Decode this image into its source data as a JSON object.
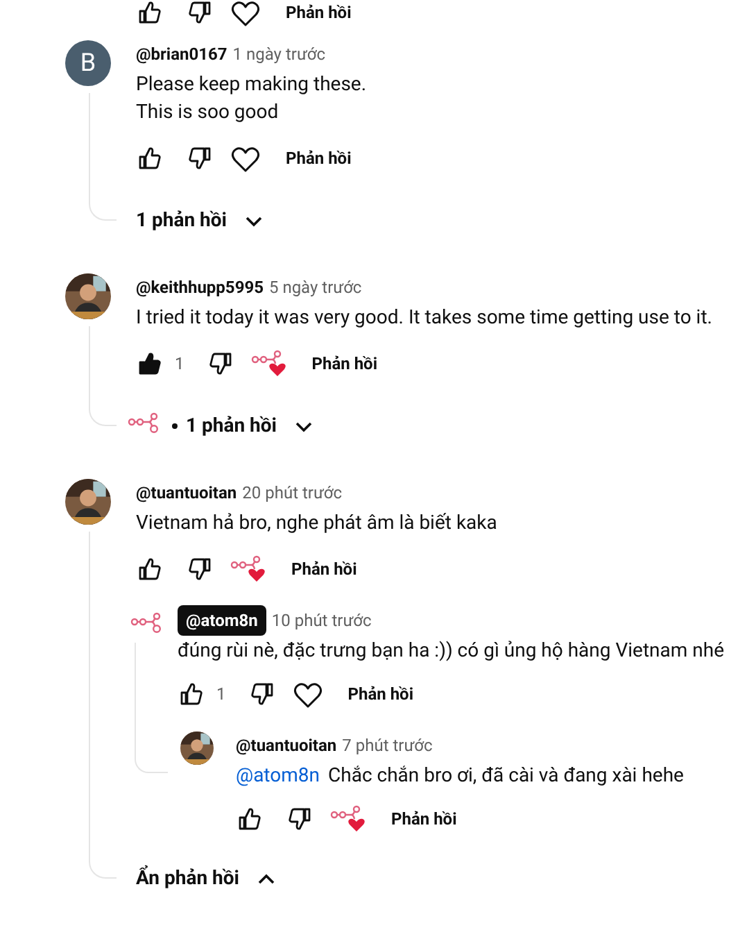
{
  "top_actions": {
    "liked": false,
    "creator_heart": false,
    "reply_label": "Phản hồi"
  },
  "comments": [
    {
      "author": "@brian0167",
      "owner": false,
      "time": "1 ngày trước",
      "avatar": {
        "kind": "letter",
        "letter": "B",
        "color": "#4a5e6e"
      },
      "text": "Please keep making these.\nThis is soo good",
      "actions": {
        "liked": false,
        "creator_heart": false,
        "reply_label": "Phản hồi"
      },
      "replies_toggle": {
        "label": "1 phản hồi",
        "expanded": false,
        "creator": false
      }
    },
    {
      "author": "@keithhupp5995",
      "owner": false,
      "time": "5 ngày trước",
      "avatar": {
        "kind": "picture"
      },
      "text": "I tried it today it was very good. It takes some time getting use to it.",
      "actions": {
        "liked": true,
        "like_count": "1",
        "creator_heart": true,
        "reply_label": "Phản hồi"
      },
      "replies_toggle": {
        "label": "1 phản hồi",
        "expanded": false,
        "creator": true
      }
    },
    {
      "author": "@tuantuoitan",
      "owner": false,
      "time": "20 phút trước",
      "avatar": {
        "kind": "picture"
      },
      "text": "Vietnam hả bro, nghe phát âm là biết kaka",
      "actions": {
        "liked": false,
        "creator_heart": true,
        "reply_label": "Phản hồi"
      },
      "replies_toggle": {
        "label": "Ẩn phản hồi",
        "expanded": true,
        "creator": false
      },
      "replies": [
        {
          "author": "@atom8n",
          "owner": true,
          "time": "10 phút trước",
          "avatar": {
            "kind": "creator"
          },
          "text": "đúng rùi nè, đặc trưng bạn ha :)) có gì ủng hộ hàng Vietnam nhé",
          "actions": {
            "liked": false,
            "like_count": "1",
            "creator_heart": false,
            "reply_label": "Phản hồi"
          }
        },
        {
          "author": "@tuantuoitan",
          "owner": false,
          "time": "7 phút trước",
          "avatar": {
            "kind": "picture"
          },
          "mention": "@atom8n",
          "text": "Chắc chắn bro ơi, đã cài và đang xài hehe",
          "actions": {
            "liked": false,
            "creator_heart": true,
            "reply_label": "Phản hồi"
          }
        }
      ]
    }
  ]
}
